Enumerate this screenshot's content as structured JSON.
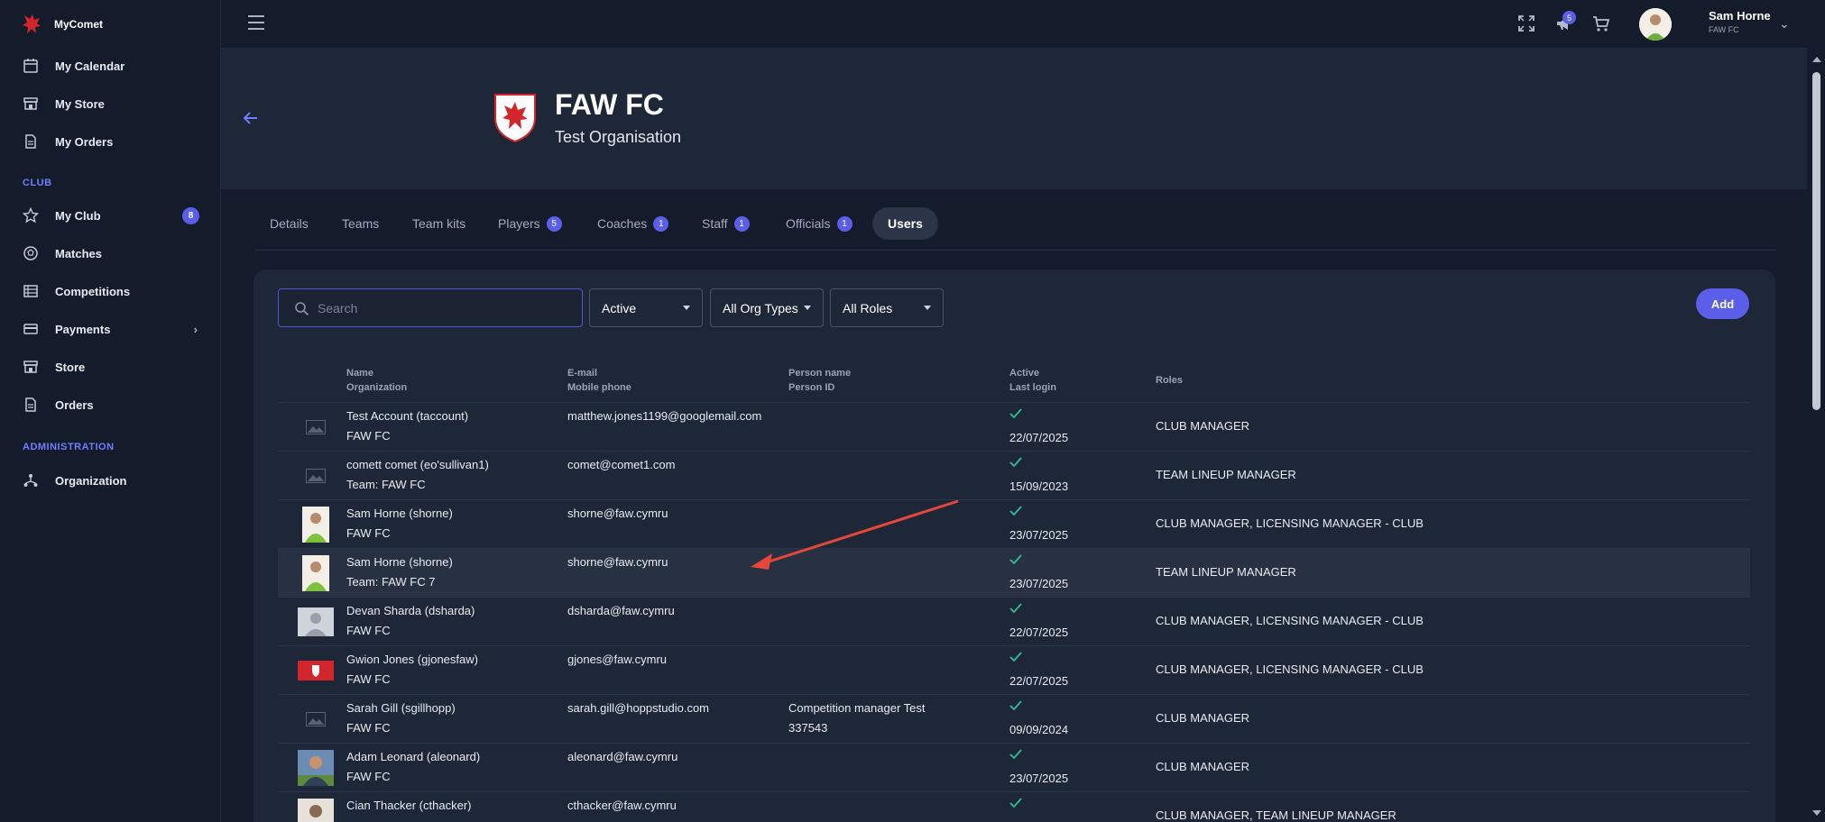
{
  "brand": {
    "name": "MyComet"
  },
  "sidebar": {
    "items": [
      {
        "label": "My Calendar",
        "icon": "calendar-icon"
      },
      {
        "label": "My Store",
        "icon": "store-icon"
      },
      {
        "label": "My Orders",
        "icon": "document-icon"
      },
      {
        "label": "My Club",
        "icon": "star-icon",
        "badge": "8"
      },
      {
        "label": "Matches",
        "icon": "soccer-ball-icon"
      },
      {
        "label": "Competitions",
        "icon": "table-icon"
      },
      {
        "label": "Payments",
        "icon": "credit-card-icon"
      },
      {
        "label": "Store",
        "icon": "store-icon"
      },
      {
        "label": "Orders",
        "icon": "document-icon"
      },
      {
        "label": "Organization",
        "icon": "hierarchy-icon"
      }
    ],
    "sections": {
      "club": "CLUB",
      "administration": "ADMINISTRATION"
    }
  },
  "header": {
    "notifications_count": "5",
    "user_name": "Sam Horne",
    "user_org": "FAW FC"
  },
  "org": {
    "name": "FAW FC",
    "subtitle": "Test Organisation"
  },
  "tabs": [
    {
      "label": "Details"
    },
    {
      "label": "Teams"
    },
    {
      "label": "Team kits"
    },
    {
      "label": "Players",
      "count": "5"
    },
    {
      "label": "Coaches",
      "count": "1"
    },
    {
      "label": "Staff",
      "count": "1"
    },
    {
      "label": "Officials",
      "count": "1"
    },
    {
      "label": "Users",
      "active": true
    }
  ],
  "filters": {
    "search_placeholder": "Search",
    "status": "Active",
    "org_types": "All Org Types",
    "roles": "All Roles",
    "add_label": "Add"
  },
  "table": {
    "headers": {
      "name": "Name",
      "organization": "Organization",
      "email": "E-mail",
      "mobile": "Mobile phone",
      "person_name": "Person name",
      "person_id": "Person ID",
      "active": "Active",
      "last_login": "Last login",
      "roles": "Roles"
    },
    "rows": [
      {
        "name": "Test Account (taccount)",
        "org": "FAW FC",
        "email": "matthew.jones1199@googlemail.com",
        "person_name": "",
        "person_id": "",
        "last_login": "22/07/2025",
        "roles": "CLUB MANAGER",
        "thumb": "placeholder"
      },
      {
        "name": "comett comet (eo'sullivan1)",
        "org": "Team: FAW FC",
        "email": "comet@comet1.com",
        "person_name": "",
        "person_id": "",
        "last_login": "15/09/2023",
        "roles": "TEAM LINEUP MANAGER",
        "thumb": "placeholder"
      },
      {
        "name": "Sam Horne (shorne)",
        "org": "FAW FC",
        "email": "shorne@faw.cymru",
        "person_name": "",
        "person_id": "",
        "last_login": "23/07/2025",
        "roles": "CLUB MANAGER, LICENSING MANAGER - CLUB",
        "thumb": "photo-green"
      },
      {
        "name": "Sam Horne (shorne)",
        "org": "Team: FAW FC 7",
        "email": "shorne@faw.cymru",
        "person_name": "",
        "person_id": "",
        "last_login": "23/07/2025",
        "roles": "TEAM LINEUP MANAGER",
        "thumb": "photo-green"
      },
      {
        "name": "Devan Sharda (dsharda)",
        "org": "FAW FC",
        "email": "dsharda@faw.cymru",
        "person_name": "",
        "person_id": "",
        "last_login": "22/07/2025",
        "roles": "CLUB MANAGER, LICENSING MANAGER - CLUB",
        "thumb": "silhouette"
      },
      {
        "name": "Gwion Jones (gjonesfaw)",
        "org": "FAW FC",
        "email": "gjones@faw.cymru",
        "person_name": "",
        "person_id": "",
        "last_login": "22/07/2025",
        "roles": "CLUB MANAGER, LICENSING MANAGER - CLUB",
        "thumb": "red-crest"
      },
      {
        "name": "Sarah Gill (sgillhopp)",
        "org": "FAW FC",
        "email": "sarah.gill@hoppstudio.com",
        "person_name": "Competition manager Test",
        "person_id": "337543",
        "last_login": "09/09/2024",
        "roles": "CLUB MANAGER",
        "thumb": "placeholder"
      },
      {
        "name": "Adam Leonard (aleonard)",
        "org": "FAW FC",
        "email": "aleonard@faw.cymru",
        "person_name": "",
        "person_id": "",
        "last_login": "23/07/2025",
        "roles": "CLUB MANAGER",
        "thumb": "photo-blue"
      },
      {
        "name": "Cian Thacker (cthacker)",
        "org": "",
        "email": "cthacker@faw.cymru",
        "person_name": "",
        "person_id": "",
        "last_login": "",
        "roles": "CLUB MANAGER, TEAM LINEUP MANAGER",
        "thumb": "photo-dark"
      }
    ]
  },
  "colors": {
    "accent": "#5a5ee8",
    "link": "#6f7fff",
    "check": "#2fbf9a",
    "annotation": "#e5473b"
  }
}
